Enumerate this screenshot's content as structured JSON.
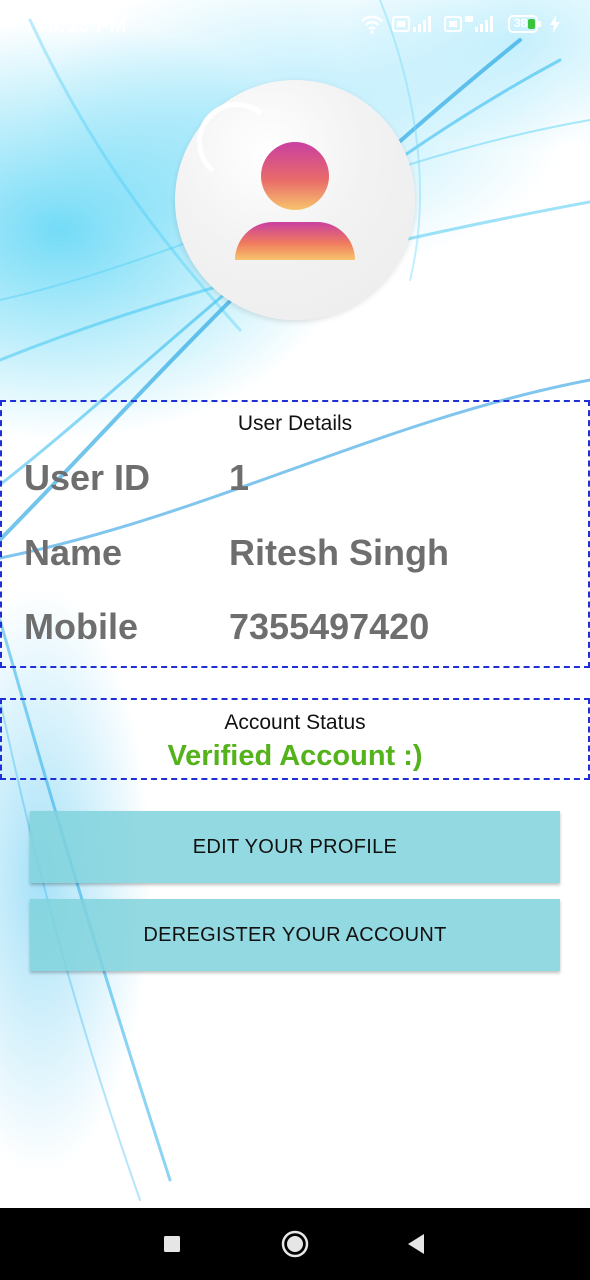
{
  "status_bar": {
    "time": "10:15 PM",
    "battery_level": "38",
    "icons": [
      "wifi-icon",
      "signal-icon-sim1",
      "signal-icon-sim2",
      "battery-icon",
      "charging-icon"
    ]
  },
  "avatar": {
    "icon": "user-avatar-icon",
    "gradient_colors": [
      "#c93fa0",
      "#e86a6a",
      "#f7c46d"
    ]
  },
  "user_details": {
    "caption": "User Details",
    "rows": [
      {
        "label": "User ID",
        "value": "1"
      },
      {
        "label": "Name",
        "value": "Ritesh Singh"
      },
      {
        "label": "Mobile",
        "value": "7355497420"
      }
    ]
  },
  "account_status": {
    "caption": "Account Status",
    "value": "Verified Account :)",
    "value_color": "#54b21b"
  },
  "buttons": {
    "edit_label": "EDIT YOUR PROFILE",
    "deregister_label": "DEREGISTER YOUR ACCOUNT",
    "color": "#80d2dc"
  },
  "nav_bar": {
    "icons": [
      "recents-icon",
      "home-icon",
      "back-icon"
    ]
  },
  "colors": {
    "box_border": "#1f2fd6",
    "label_text": "#6e6e6e"
  }
}
